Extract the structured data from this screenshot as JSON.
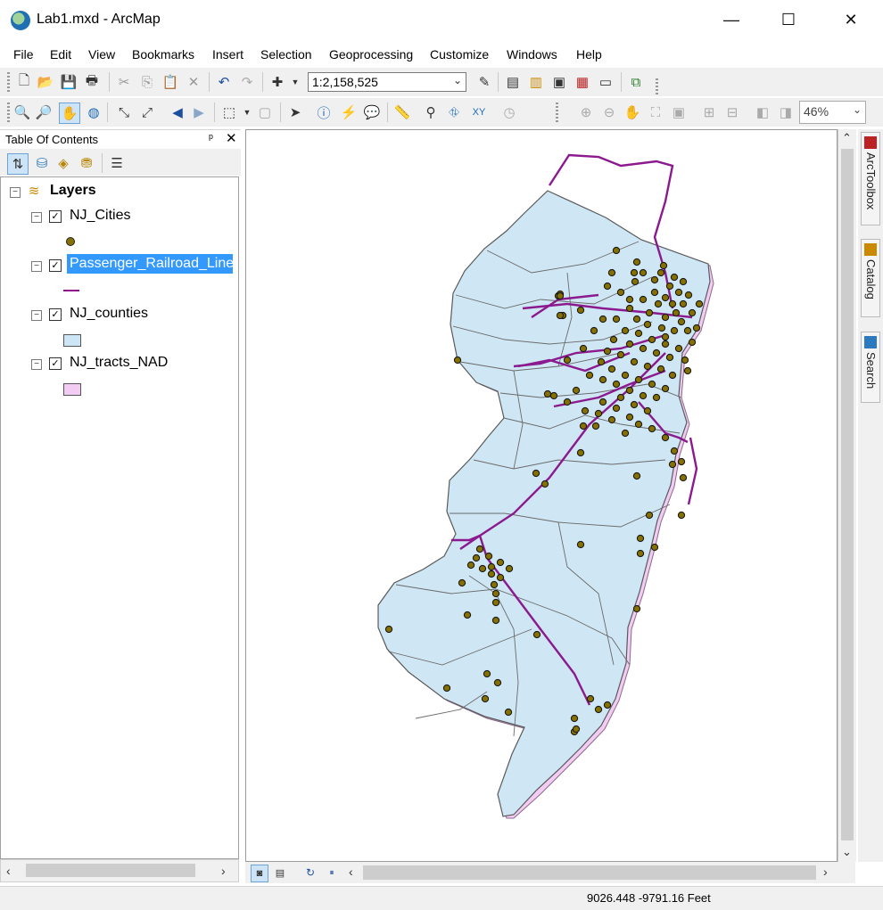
{
  "window": {
    "title": "Lab1.mxd - ArcMap",
    "controls": {
      "minimize": "—",
      "maximize": "☐",
      "close": "✕"
    }
  },
  "menu": [
    "File",
    "Edit",
    "View",
    "Bookmarks",
    "Insert",
    "Selection",
    "Geoprocessing",
    "Customize",
    "Windows",
    "Help"
  ],
  "toolbar": {
    "scale": "1:2,158,525",
    "zoom_percent": "46%"
  },
  "toc": {
    "title": "Table Of Contents",
    "pin": "ᵖ",
    "close": "✕",
    "root_label": "Layers",
    "layers": [
      {
        "name": "NJ_Cities",
        "checked": true,
        "symbol": "point",
        "color": "#7a6a00"
      },
      {
        "name": "Passenger_Railroad_Line",
        "checked": true,
        "selected": true,
        "symbol": "line",
        "color": "#8e0e8e"
      },
      {
        "name": "NJ_counties",
        "checked": true,
        "symbol": "polygon",
        "color": "#cce6f5"
      },
      {
        "name": "NJ_tracts_NAD",
        "checked": true,
        "symbol": "polygon",
        "color": "#f2ccf2"
      }
    ]
  },
  "dock_tabs": [
    "ArcToolbox",
    "Catalog",
    "Search"
  ],
  "status": {
    "coordinates": "9026.448  -9791.16 Feet"
  },
  "colors": {
    "selection": "#3399ff",
    "map_fill": "#cfe6f4",
    "rail": "#8b1a8f",
    "city": "#857000"
  }
}
